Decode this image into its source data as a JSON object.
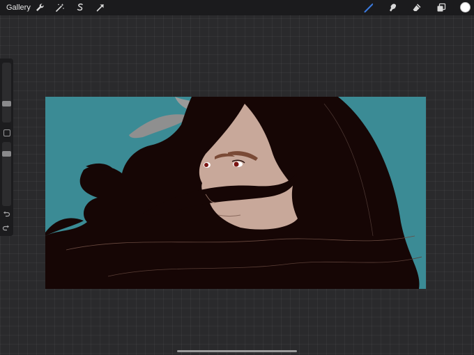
{
  "topbar": {
    "gallery_label": "Gallery",
    "left_tools": [
      "wrench-icon",
      "magic-wand-icon",
      "selection-icon",
      "transform-arrow-icon"
    ],
    "right_tools": [
      "brush-icon",
      "smudge-icon",
      "eraser-icon",
      "layers-icon"
    ],
    "active_tool": "brush",
    "current_color": "#ffffff"
  },
  "sidebar": {
    "brush_size_level": 0.3,
    "opacity_level": 0.85
  },
  "colors": {
    "background_teal": "#3b8b95",
    "hair": "#160605",
    "skin": "#c8a89a",
    "brow": "#7a4a36",
    "eye": "#7a1412",
    "active_blue": "#3b7be0"
  }
}
